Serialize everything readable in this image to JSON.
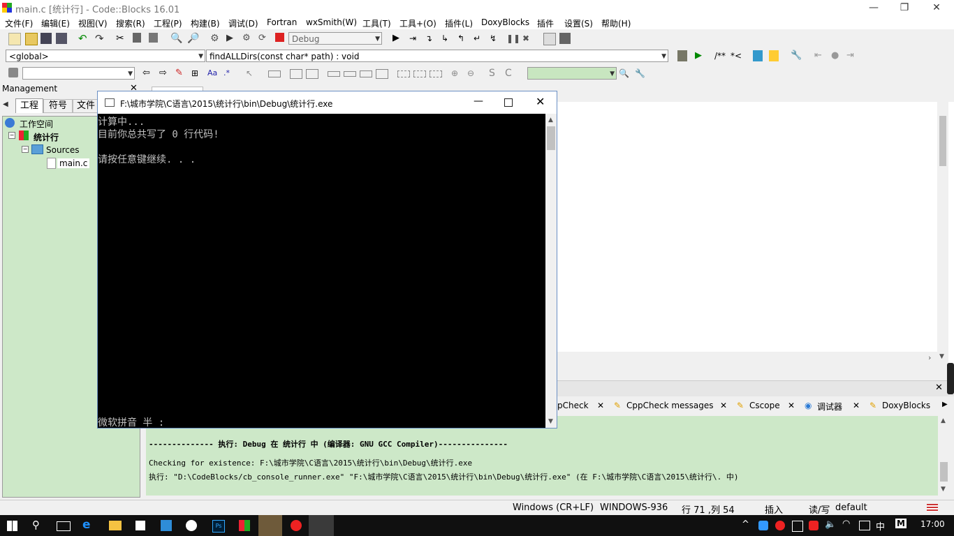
{
  "window": {
    "title": "main.c [统计行] - Code::Blocks 16.01",
    "min": "—",
    "restore": "❐",
    "close": "✕"
  },
  "menu": [
    "文件(F)",
    "编辑(E)",
    "视图(V)",
    "搜索(R)",
    "工程(P)",
    "构建(B)",
    "调试(D)",
    "Fortran",
    "wxSmith(W)",
    "工具(T)",
    "工具+(O)",
    "插件(L)",
    "DoxyBlocks",
    "插件",
    "设置(S)",
    "帮助(H)"
  ],
  "toolbar": {
    "build_target": "Debug",
    "scope": "<global>",
    "function": "findALLDirs(const char* path) : void",
    "comment_a": "/**",
    "comment_b": "*<"
  },
  "management": {
    "title": "Management",
    "tabs": [
      "工程",
      "符号",
      "文件"
    ],
    "tree": {
      "workspace": "工作空间",
      "project": "统计行",
      "folder": "Sources",
      "file": "main.c"
    }
  },
  "console": {
    "title": "F:\\城市学院\\C语言\\2015\\统计行\\bin\\Debug\\统计行.exe",
    "lines": [
      "计算中...",
      "目前你总共写了 0 行代码!",
      "",
      "请按任意键继续. . ."
    ],
    "ime": "微软拼音 半 :"
  },
  "log_tabs": [
    "pCheck",
    "CppCheck messages",
    "Cscope",
    "调试器",
    "DoxyBlocks"
  ],
  "log": [
    "-------------- 执行: Debug 在 统计行 中 (编译器: GNU GCC Compiler)---------------",
    "Checking for existence: F:\\城市学院\\C语言\\2015\\统计行\\bin\\Debug\\统计行.exe",
    "执行: \"D:\\CodeBlocks/cb_console_runner.exe\" \"F:\\城市学院\\C语言\\2015\\统计行\\bin\\Debug\\统计行.exe\"  (在 F:\\城市学院\\C语言\\2015\\统计行\\. 中)"
  ],
  "status": {
    "eol": "Windows (CR+LF)",
    "encoding": "WINDOWS-936",
    "position": "行 71 ,列 54",
    "mode": "插入",
    "rw": "读/写",
    "scheme": "default"
  },
  "taskbar": {
    "time": "17:00",
    "ime_lang": "中",
    "ime_mode": "M"
  }
}
